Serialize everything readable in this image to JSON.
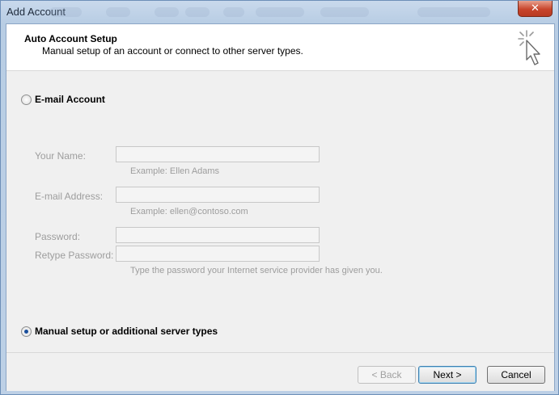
{
  "window": {
    "title": "Add Account",
    "close_glyph": "✕"
  },
  "header": {
    "title": "Auto Account Setup",
    "subtitle": "Manual setup of an account or connect to other server types.",
    "icon": "wizard-cursor-icon"
  },
  "options": {
    "email_account": {
      "label": "E-mail Account",
      "selected": false
    },
    "manual_setup": {
      "label": "Manual setup or additional server types",
      "selected": true
    }
  },
  "form": {
    "your_name": {
      "label": "Your Name:",
      "value": "",
      "example": "Example: Ellen Adams"
    },
    "email_address": {
      "label": "E-mail Address:",
      "value": "",
      "example": "Example: ellen@contoso.com"
    },
    "password": {
      "label": "Password:",
      "value": ""
    },
    "retype_password": {
      "label": "Retype Password:",
      "value": ""
    },
    "password_hint": "Type the password your Internet service provider has given you."
  },
  "buttons": {
    "back": "< Back",
    "next": "Next >",
    "cancel": "Cancel"
  }
}
